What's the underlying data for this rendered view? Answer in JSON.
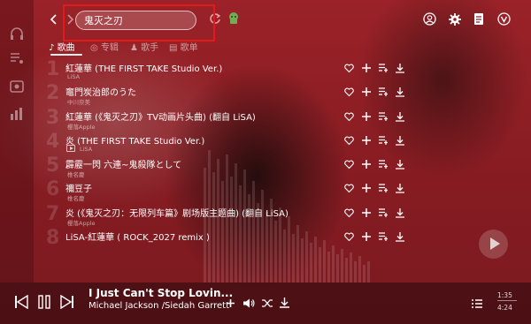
{
  "search": {
    "value": "鬼灭之刃"
  },
  "tabs": [
    {
      "label": "歌曲"
    },
    {
      "label": "专辑"
    },
    {
      "label": "歌手"
    },
    {
      "label": "歌单"
    }
  ],
  "songs": [
    {
      "rank": "1",
      "title": "紅蓮華 (THE FIRST TAKE Studio Ver.)",
      "artist": "LiSA"
    },
    {
      "rank": "2",
      "title": "竈門炭治郎のうた",
      "artist": "中川奈美"
    },
    {
      "rank": "3",
      "title": "紅蓮華 (《鬼灭之刃》TV动画片头曲) (翻自 LiSA)",
      "artist": "樱落Apple"
    },
    {
      "rank": "4",
      "title": "炎 (THE FIRST TAKE Studio Ver.)",
      "artist": "LiSA"
    },
    {
      "rank": "5",
      "title": "霹靂一閃 六連~鬼殺隊として",
      "artist": "椎名慶"
    },
    {
      "rank": "6",
      "title": "禰豆子",
      "artist": "椎名慶"
    },
    {
      "rank": "7",
      "title": "炎 (《鬼灭之刃：无限列车篇》剧场版主题曲) (翻自 LiSA)",
      "artist": "樱落Apple"
    },
    {
      "rank": "8",
      "title": "LiSA-紅蓮華 ( ROCK_2027 remix )",
      "artist": ""
    }
  ],
  "player": {
    "title": "I Just Can't Stop Lovin...",
    "artist": "Michael Jackson /Siedah Garrett",
    "current_time": "1:35",
    "total_time": "4:24"
  },
  "colors": {
    "background": "#8a1f25",
    "highlight": "#e21a1a"
  },
  "icons": [
    "back-icon",
    "forward-icon",
    "refresh-icon",
    "skin-icon",
    "user-icon",
    "settings-icon",
    "notes-icon",
    "vip-icon",
    "heart-icon",
    "plus-icon",
    "add-to-list-icon",
    "download-icon",
    "play-icon",
    "prev-icon",
    "pause-icon",
    "next-icon",
    "volume-icon",
    "shuffle-icon",
    "playlist-icon"
  ]
}
